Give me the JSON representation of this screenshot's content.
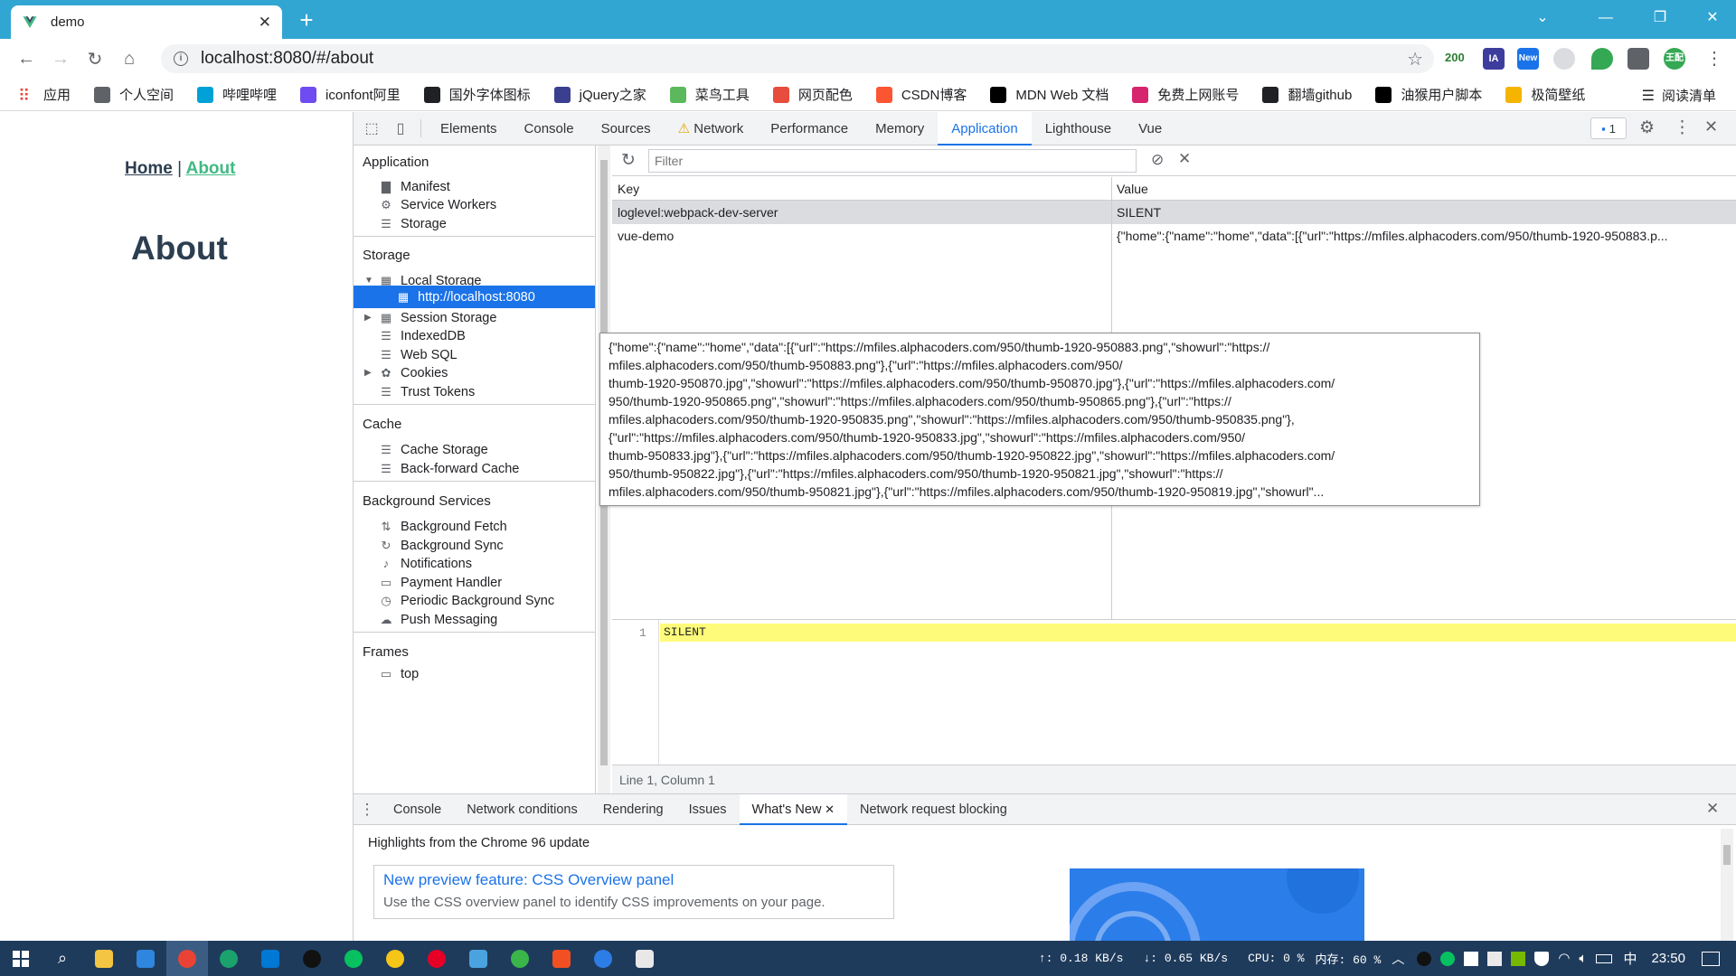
{
  "browser": {
    "tab_title": "demo",
    "url": "localhost:8080/#/about",
    "extension_badge": "200",
    "ext_new": "New",
    "ext_profile": "王配"
  },
  "bookmarks": [
    {
      "label": "应用",
      "color": "#ea4335"
    },
    {
      "label": "个人空间",
      "color": "#5f6368"
    },
    {
      "label": "哔哩哔哩",
      "color": "#00a1d6"
    },
    {
      "label": "iconfont阿里",
      "color": "#6f4cf1"
    },
    {
      "label": "国外字体图标",
      "color": "#202124"
    },
    {
      "label": "jQuery之家",
      "color": "#3b3f8f"
    },
    {
      "label": "菜鸟工具",
      "color": "#5cb85c"
    },
    {
      "label": "网页配色",
      "color": "#e74c3c"
    },
    {
      "label": "CSDN博客",
      "color": "#fc5531"
    },
    {
      "label": "MDN Web 文档",
      "color": "#000000"
    },
    {
      "label": "免费上网账号",
      "color": "#d6246e"
    },
    {
      "label": "翻墙github",
      "color": "#202124"
    },
    {
      "label": "油猴用户脚本",
      "color": "#000000"
    },
    {
      "label": "极简壁纸",
      "color": "#f4b400"
    }
  ],
  "reading_list": "阅读清单",
  "page": {
    "nav_home": "Home",
    "nav_sep": "|",
    "nav_about": "About",
    "heading": "About"
  },
  "devtools": {
    "tabs": [
      "Elements",
      "Console",
      "Sources",
      "Network",
      "Performance",
      "Memory",
      "Application",
      "Lighthouse",
      "Vue"
    ],
    "active_tab": "Application",
    "issues_count": "1",
    "sidebar": {
      "application_header": "Application",
      "application_items": [
        {
          "label": "Manifest",
          "icon": "file-icon"
        },
        {
          "label": "Service Workers",
          "icon": "gear-icon"
        },
        {
          "label": "Storage",
          "icon": "database-icon"
        }
      ],
      "storage_header": "Storage",
      "storage_items": [
        {
          "label": "Local Storage",
          "icon": "grid-icon"
        },
        {
          "label": "http://localhost:8080",
          "icon": "grid-icon"
        },
        {
          "label": "Session Storage",
          "icon": "grid-icon"
        },
        {
          "label": "IndexedDB",
          "icon": "database-icon"
        },
        {
          "label": "Web SQL",
          "icon": "database-icon"
        },
        {
          "label": "Cookies",
          "icon": "cookie-icon"
        },
        {
          "label": "Trust Tokens",
          "icon": "database-icon"
        }
      ],
      "cache_header": "Cache",
      "cache_items": [
        {
          "label": "Cache Storage",
          "icon": "database-icon"
        },
        {
          "label": "Back-forward Cache",
          "icon": "database-icon"
        }
      ],
      "bg_header": "Background Services",
      "bg_items": [
        {
          "label": "Background Fetch",
          "icon": "arrows-icon"
        },
        {
          "label": "Background Sync",
          "icon": "sync-icon"
        },
        {
          "label": "Notifications",
          "icon": "bell-icon"
        },
        {
          "label": "Payment Handler",
          "icon": "card-icon"
        },
        {
          "label": "Periodic Background Sync",
          "icon": "clock-icon"
        },
        {
          "label": "Push Messaging",
          "icon": "cloud-icon"
        }
      ],
      "frames_header": "Frames",
      "frames_item": "top"
    },
    "filter_placeholder": "Filter",
    "table": {
      "headers": [
        "Key",
        "Value"
      ],
      "rows": [
        {
          "key": "loglevel:webpack-dev-server",
          "value": "SILENT"
        },
        {
          "key": "vue-demo",
          "value": "{\"home\":{\"name\":\"home\",\"data\":[{\"url\":\"https://mfiles.alphacoders.com/950/thumb-1920-950883.p..."
        }
      ]
    },
    "tooltip_lines": [
      "{\"home\":{\"name\":\"home\",\"data\":[{\"url\":\"https://mfiles.alphacoders.com/950/thumb-1920-950883.png\",\"showurl\":\"https://",
      "mfiles.alphacoders.com/950/thumb-950883.png\"},{\"url\":\"https://mfiles.alphacoders.com/950/",
      "thumb-1920-950870.jpg\",\"showurl\":\"https://mfiles.alphacoders.com/950/thumb-950870.jpg\"},{\"url\":\"https://mfiles.alphacoders.com/",
      "950/thumb-1920-950865.png\",\"showurl\":\"https://mfiles.alphacoders.com/950/thumb-950865.png\"},{\"url\":\"https://",
      "mfiles.alphacoders.com/950/thumb-1920-950835.png\",\"showurl\":\"https://mfiles.alphacoders.com/950/thumb-950835.png\"},",
      "{\"url\":\"https://mfiles.alphacoders.com/950/thumb-1920-950833.jpg\",\"showurl\":\"https://mfiles.alphacoders.com/950/",
      "thumb-950833.jpg\"},{\"url\":\"https://mfiles.alphacoders.com/950/thumb-1920-950822.jpg\",\"showurl\":\"https://mfiles.alphacoders.com/",
      "950/thumb-950822.jpg\"},{\"url\":\"https://mfiles.alphacoders.com/950/thumb-1920-950821.jpg\",\"showurl\":\"https://",
      "mfiles.alphacoders.com/950/thumb-950821.jpg\"},{\"url\":\"https://mfiles.alphacoders.com/950/thumb-1920-950819.jpg\",\"showurl\"..."
    ],
    "preview": {
      "line_number": "1",
      "line_text": "SILENT",
      "status": "Line 1, Column 1"
    },
    "drawer": {
      "tabs": [
        "Console",
        "Network conditions",
        "Rendering",
        "Issues",
        "What's New",
        "Network request blocking"
      ],
      "active_tab": "What's New",
      "highlight": "Highlights from the Chrome 96 update",
      "card_title": "New preview feature: CSS Overview panel",
      "card_desc": "Use the CSS overview panel to identify CSS improvements on your page."
    }
  },
  "taskbar": {
    "upload": "↑: 0.18 KB/s",
    "download": "↓: 0.65 KB/s",
    "cpu": "CPU: 0 %",
    "mem": "内存: 60 %",
    "ime": "中",
    "time": "23:50"
  },
  "colors": {
    "tabbar": "#32a6d2",
    "accent": "#1a73e8",
    "vue_green": "#42b983",
    "taskbar": "#1f3b5c"
  }
}
